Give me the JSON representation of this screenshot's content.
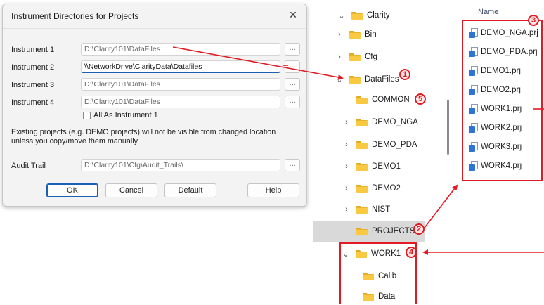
{
  "dialog": {
    "title": "Instrument Directories for Projects",
    "close_glyph": "✕",
    "rows": [
      {
        "label": "Instrument 1",
        "value": "D:\\Clarity101\\DataFiles",
        "browse": "..."
      },
      {
        "label": "Instrument 2",
        "value": "\\\\NetworkDrive\\ClarityData\\Datafiles",
        "browse": "..."
      },
      {
        "label": "Instrument 3",
        "value": "D:\\Clarity101\\DataFiles",
        "browse": "..."
      },
      {
        "label": "Instrument 4",
        "value": "D:\\Clarity101\\DataFiles",
        "browse": "..."
      }
    ],
    "checkbox_label": "All As Instrument 1",
    "checkbox_checked": false,
    "note": "Existing projects (e.g. DEMO projects) will not be visible from changed location unless you copy/move them manually",
    "audit": {
      "label": "Audit Trail",
      "value": "D:\\Clarity101\\Cfg\\Audit_Trails\\",
      "browse": "..."
    },
    "buttons": {
      "ok": "OK",
      "cancel": "Cancel",
      "default": "Default",
      "help": "Help"
    }
  },
  "tree": {
    "items": [
      {
        "label": "Clarity",
        "chevron": "⌄"
      },
      {
        "label": "Bin",
        "chevron": "›"
      },
      {
        "label": "Cfg",
        "chevron": "›"
      },
      {
        "label": "DataFiles",
        "chevron": "⌄"
      },
      {
        "label": "COMMON",
        "chevron": ""
      },
      {
        "label": "DEMO_NGA",
        "chevron": "›"
      },
      {
        "label": "DEMO_PDA",
        "chevron": "›"
      },
      {
        "label": "DEMO1",
        "chevron": "›"
      },
      {
        "label": "DEMO2",
        "chevron": "›"
      },
      {
        "label": "NIST",
        "chevron": "›"
      },
      {
        "label": "PROJECTS",
        "chevron": ""
      },
      {
        "label": "WORK1",
        "chevron": "⌄"
      },
      {
        "label": "Calib",
        "chevron": ""
      },
      {
        "label": "Data",
        "chevron": ""
      }
    ],
    "selected": "PROJECTS"
  },
  "files": {
    "header": "Name",
    "items": [
      "DEMO_NGA.prj",
      "DEMO_PDA.prj",
      "DEMO1.prj",
      "DEMO2.prj",
      "WORK1.prj",
      "WORK2.prj",
      "WORK3.prj",
      "WORK4.prj"
    ]
  },
  "annotations": {
    "badges": [
      "1",
      "2",
      "3",
      "4",
      "5"
    ],
    "color": "#e01b24"
  },
  "colors": {
    "accent": "#1a5fb4",
    "folder": "#f8c941",
    "selection": "#d9d9d9"
  }
}
